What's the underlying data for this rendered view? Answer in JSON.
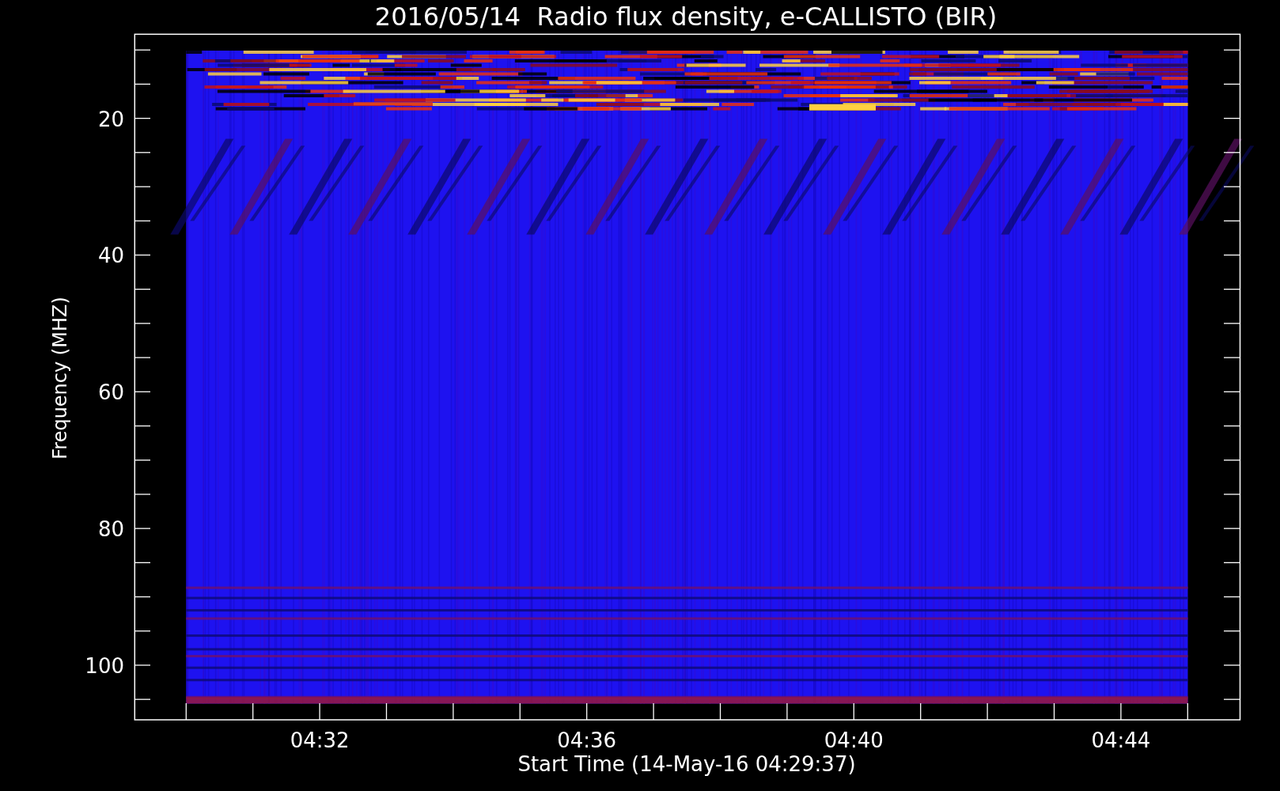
{
  "plot": {
    "title": "2016/05/14  Radio flux density, e-CALLISTO (BIR)",
    "ylabel": "Frequency (MHZ)",
    "xlabel": "Start Time (14-May-16 04:29:37)",
    "yticks": [
      "20",
      "40",
      "60",
      "80",
      "100"
    ],
    "xticks": [
      "04:32",
      "04:36",
      "04:40",
      "04:44"
    ]
  }
}
